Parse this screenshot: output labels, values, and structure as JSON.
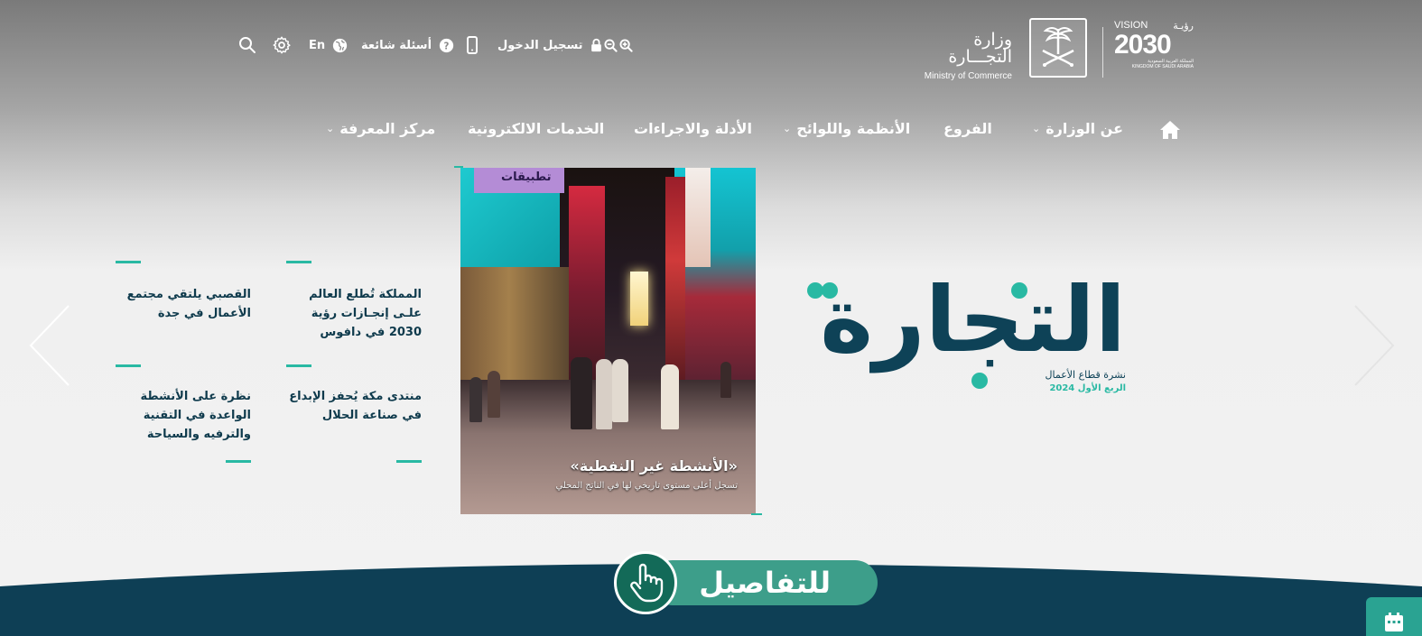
{
  "header": {
    "ministry_ar": "وزارة التجـــارة",
    "ministry_en": "Ministry of Commerce",
    "vision_ar": "رؤيـة",
    "vision_en": "VISION",
    "vision_year": "2030",
    "vision_kingdom_ar": "المملكة العربية السعودية",
    "vision_kingdom_en": "KINGDOM OF SAUDI ARABIA"
  },
  "utility": {
    "login": "تسجيل الدخول",
    "faq": "أسئلة شائعة",
    "language": "En"
  },
  "nav": {
    "items": [
      {
        "label": "عن الوزارة",
        "dropdown": true
      },
      {
        "label": "الفروع",
        "dropdown": false
      },
      {
        "label": "الأنظمة واللوائح",
        "dropdown": true
      },
      {
        "label": "الأدلة والاجراءات",
        "dropdown": false
      },
      {
        "label": "الخدمات الالكترونية",
        "dropdown": false
      },
      {
        "label": "مركز المعرفة",
        "dropdown": true
      }
    ]
  },
  "hero": {
    "brand_word": "التجارة",
    "brand_sub1": "نشرة قطاع الأعمال",
    "brand_sub2": "الربع الأول 2024",
    "cover_sign": "تطبيقات",
    "cover_title": "«الأنشطة غير النفطية»",
    "cover_subtitle": "تسجل أعلى مستوى تاريخي لها في الناتج المحلي"
  },
  "news": [
    {
      "title": "المملكة تُطلع العالم علـى إنجـازات رؤية 2030 في دافوس"
    },
    {
      "title": "القصبي يلتقي مجتمع الأعمال في جدة"
    },
    {
      "title": "منتدى مكة يُحفز الإبداع في صناعة الحلال"
    },
    {
      "title": "نظرة على الأنشطة الواعدة في التقنية والترفيه والسياحة"
    }
  ],
  "cta": {
    "label": "للتفاصيل"
  },
  "colors": {
    "primary": "#0e4257",
    "accent": "#29b9a3",
    "cta": "#3d9e8a",
    "cta_dark": "#136a58"
  },
  "icons": {
    "home": "home-icon",
    "zoom_in": "zoom-in-icon",
    "zoom_out": "zoom-out-icon",
    "lock": "lock-icon",
    "mobile": "mobile-icon",
    "faq": "question-circle-icon",
    "globe": "globe-icon",
    "settings": "gear-icon",
    "search": "search-icon",
    "calendar": "calendar-icon"
  }
}
